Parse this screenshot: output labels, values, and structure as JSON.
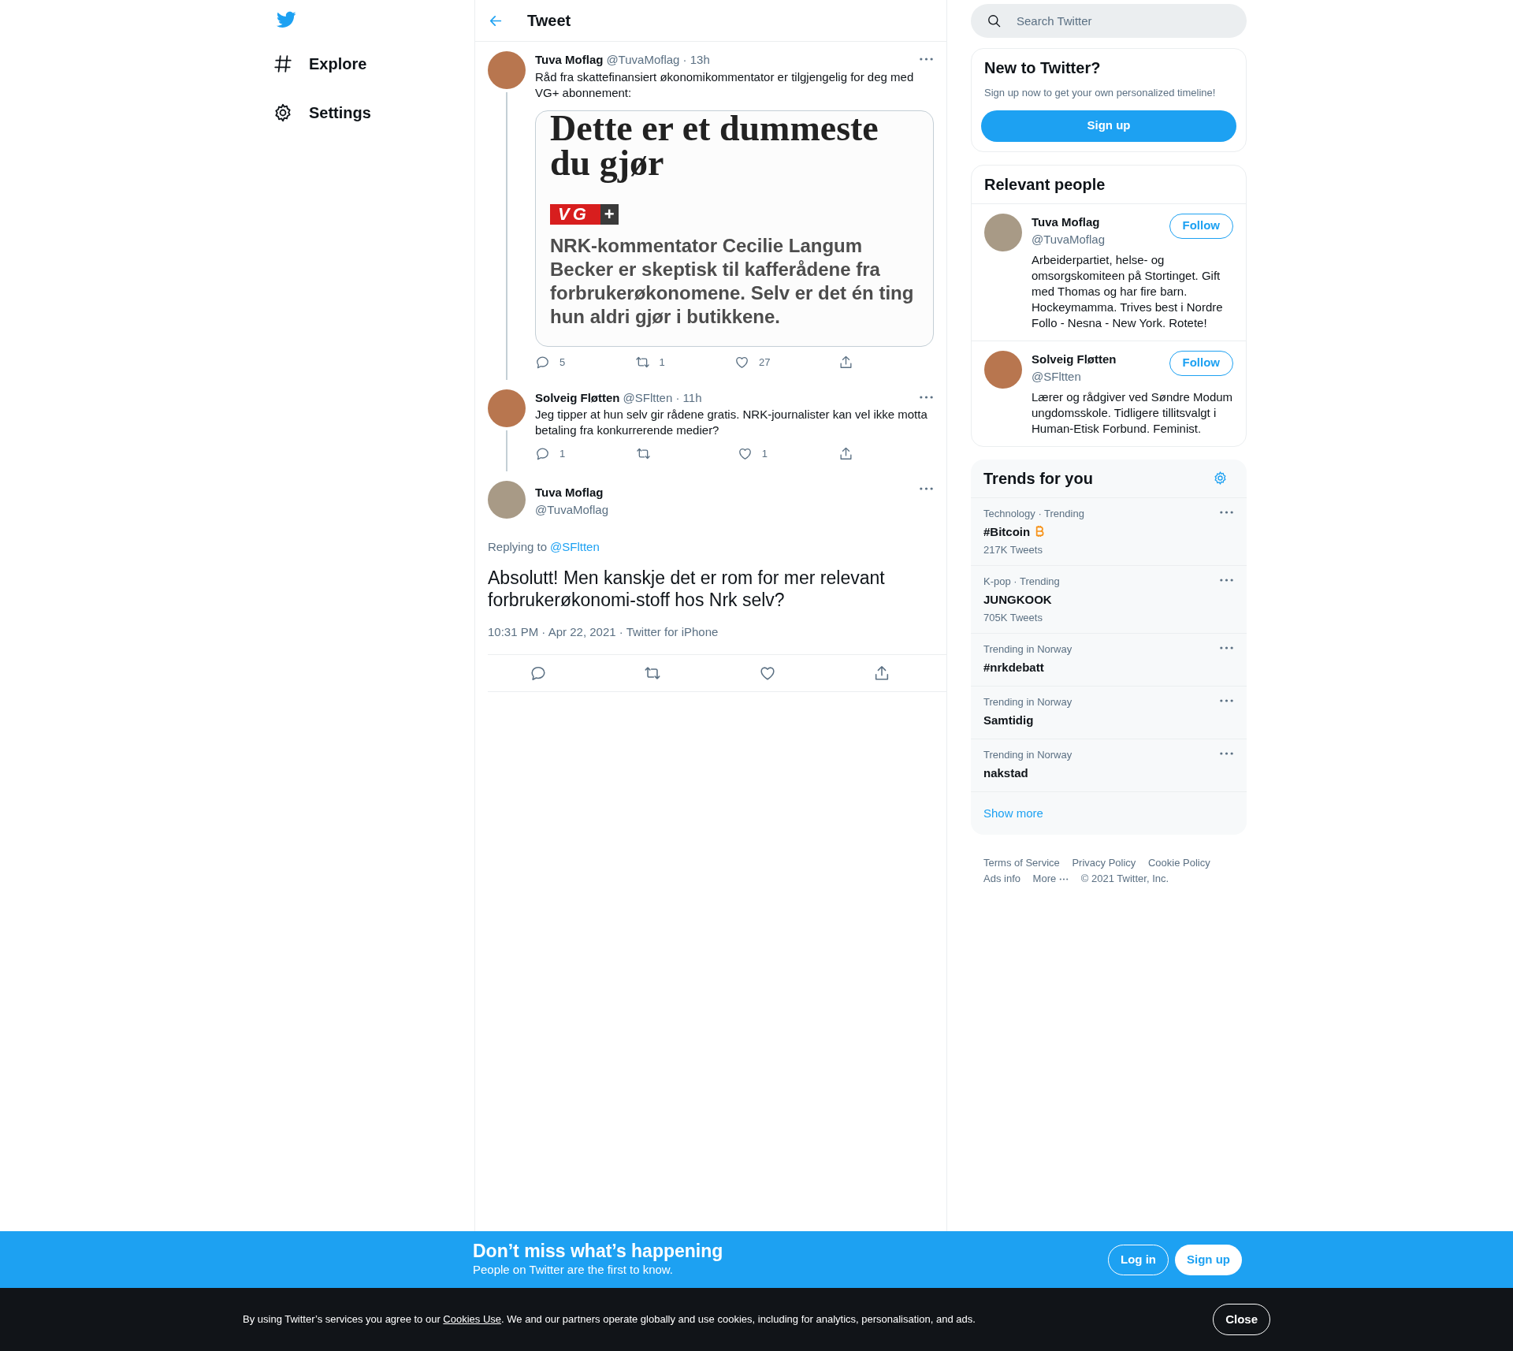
{
  "nav": {
    "items": [
      {
        "label": "Explore"
      },
      {
        "label": "Settings"
      }
    ]
  },
  "header": {
    "title": "Tweet"
  },
  "thread": [
    {
      "name": "Tuva Moflag",
      "byline": "@TuvaMoflag · 13h",
      "text": "Råd fra skattefinansiert økonomikommentator er tilgjengelig for deg med VG+ abonnement:",
      "card": {
        "headline": "Dette er et dummeste du gjør",
        "logo": {
          "left": "VG",
          "right": "+"
        },
        "summary": "NRK-kommentator Cecilie Langum Becker er skeptisk til kafferådene fra forbrukerøkonomene. Selv er det én ting hun aldri gjør i butikkene."
      },
      "replies": "5",
      "retweets": "1",
      "likes": "27"
    },
    {
      "name": "Solveig Fløtten",
      "byline": "@SFltten · 11h",
      "text": "Jeg tipper at hun selv gir rådene gratis. NRK-journalister kan vel ikke motta betaling fra konkurrerende medier?",
      "replies": "1",
      "likes": "1"
    }
  ],
  "main_tweet": {
    "name": "Tuva Moflag",
    "handle": "@TuvaMoflag",
    "replying_label": "Replying to",
    "replying_to": "@SFltten",
    "text": "Absolutt! Men kanskje det er rom for mer relevant forbrukerøkonomi-stoff hos Nrk selv?",
    "meta": "10:31 PM · Apr 22, 2021 · Twitter for iPhone"
  },
  "search": {
    "placeholder": "Search Twitter"
  },
  "signup_card": {
    "title": "New to Twitter?",
    "text": "Sign up now to get your own personalized timeline!",
    "button": "Sign up"
  },
  "relevant_people": {
    "title": "Relevant people",
    "people": [
      {
        "name": "Tuva Moflag",
        "handle": "@TuvaMoflag",
        "button": "Follow",
        "bio": "Arbeiderpartiet, helse- og omsorgskomiteen på Stortinget. Gift med Thomas og har fire barn. Hockeymamma. Trives best i Nordre Follo - Nesna - New York. Rotete!"
      },
      {
        "name": "Solveig Fløtten",
        "handle": "@SFltten",
        "button": "Follow",
        "bio": "Lærer og rådgiver ved Søndre Modum ungdomsskole. Tidligere tillitsvalgt i Human-Etisk Forbund. Feminist."
      }
    ]
  },
  "trends": {
    "title": "Trends for you",
    "items": [
      {
        "context": "Technology · Trending",
        "topic": "#Bitcoin",
        "has_emoji": true,
        "count": "217K Tweets"
      },
      {
        "context": "K-pop · Trending",
        "topic": "JUNGKOOK",
        "has_emoji": false,
        "count": "705K Tweets"
      },
      {
        "context": "Trending in Norway",
        "topic": "#nrkdebatt",
        "has_emoji": false
      },
      {
        "context": "Trending in Norway",
        "topic": "Samtidig",
        "has_emoji": false
      },
      {
        "context": "Trending in Norway",
        "topic": "nakstad",
        "has_emoji": false
      }
    ],
    "show_more": "Show more"
  },
  "footer": {
    "links": [
      "Terms of Service",
      "Privacy Policy",
      "Cookie Policy",
      "Ads info"
    ],
    "more": "More",
    "copyright": "© 2021 Twitter, Inc."
  },
  "banner": {
    "title": "Don’t miss what’s happening",
    "subtitle": "People on Twitter are the first to know.",
    "login": "Log in",
    "signup": "Sign up"
  },
  "cookie": {
    "before": "By using Twitter’s services you agree to our ",
    "link": "Cookies Use",
    "after": ". We and our partners operate globally and use cookies, including for analytics, personalisation, and ads.",
    "button": "Close"
  }
}
